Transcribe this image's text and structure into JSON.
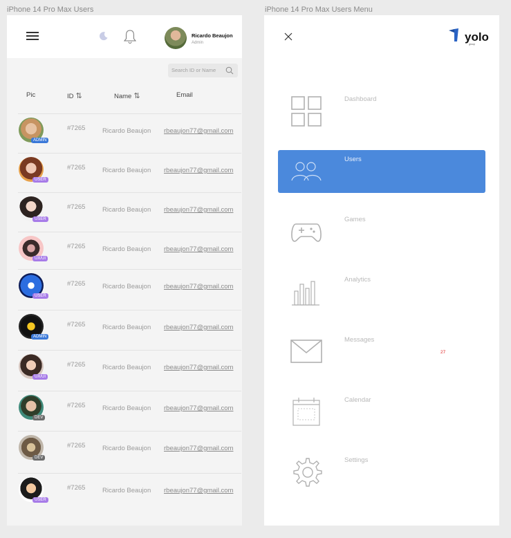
{
  "frames": {
    "left_title": "iPhone 14 Pro Max Users",
    "right_title": "iPhone 14 Pro Max Users Menu"
  },
  "header": {
    "user_name": "Ricardo Beaujon",
    "user_role": "Admin",
    "icons": [
      "menu-icon",
      "moon-icon",
      "bell-icon"
    ]
  },
  "search": {
    "placeholder": "Search ID or Name"
  },
  "table": {
    "columns": [
      "Pic",
      "ID",
      "Name",
      "Email"
    ],
    "sort_glyph": "⇅",
    "rows": [
      {
        "id": "#7265",
        "name": "Ricardo Beaujon",
        "email": "rbeaujon77@gmail.com",
        "role": "ADMIN"
      },
      {
        "id": "#7265",
        "name": "Ricardo Beaujon",
        "email": "rbeaujon77@gmail.com",
        "role": "USER"
      },
      {
        "id": "#7265",
        "name": "Ricardo Beaujon",
        "email": "rbeaujon77@gmail.com",
        "role": "USER"
      },
      {
        "id": "#7265",
        "name": "Ricardo Beaujon",
        "email": "rbeaujon77@gmail.com",
        "role": "UX/UI"
      },
      {
        "id": "#7265",
        "name": "Ricardo Beaujon",
        "email": "rbeaujon77@gmail.com",
        "role": "USER"
      },
      {
        "id": "#7265",
        "name": "Ricardo Beaujon",
        "email": "rbeaujon77@gmail.com",
        "role": "ADMIN"
      },
      {
        "id": "#7265",
        "name": "Ricardo Beaujon",
        "email": "rbeaujon77@gmail.com",
        "role": "UX/UI"
      },
      {
        "id": "#7265",
        "name": "Ricardo Beaujon",
        "email": "rbeaujon77@gmail.com",
        "role": "DEV"
      },
      {
        "id": "#7265",
        "name": "Ricardo Beaujon",
        "email": "rbeaujon77@gmail.com",
        "role": "DEV"
      },
      {
        "id": "#7265",
        "name": "Ricardo Beaujon",
        "email": "rbeaujon77@gmail.com",
        "role": "USER"
      }
    ]
  },
  "menu": {
    "logo_text": "yolo",
    "logo_sub": "group",
    "items": [
      {
        "label": "Dashboard",
        "icon": "dashboard-icon",
        "active": false
      },
      {
        "label": "Users",
        "icon": "users-icon",
        "active": true
      },
      {
        "label": "Games",
        "icon": "gamepad-icon",
        "active": false
      },
      {
        "label": "Analytics",
        "icon": "analytics-icon",
        "active": false
      },
      {
        "label": "Messages",
        "icon": "envelope-icon",
        "active": false,
        "badge": "27"
      },
      {
        "label": "Calendar",
        "icon": "calendar-icon",
        "active": false
      },
      {
        "label": "Settings",
        "icon": "gear-icon",
        "active": false
      }
    ]
  },
  "colors": {
    "accent": "#4b89dc",
    "admin_badge": "#3a78d8",
    "user_badge": "#a77be8",
    "dev_badge": "#6c6c6c",
    "alert": "#e02424"
  }
}
